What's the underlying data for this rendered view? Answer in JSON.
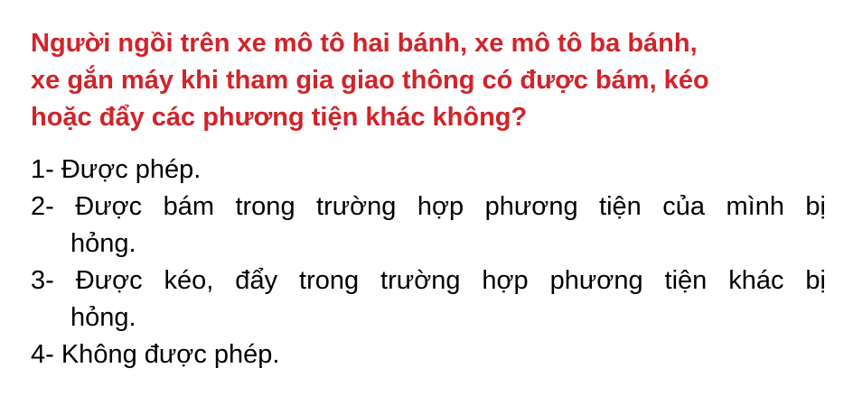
{
  "question": {
    "lines": [
      "Người ngồi trên xe mô tô hai bánh, xe mô tô ba bánh,",
      "xe gắn máy khi tham gia giao thông có được bám, kéo",
      "hoặc đẩy các phương tiện khác không?"
    ],
    "color": "#d2232a"
  },
  "answers": [
    {
      "lines": [
        "1- Được phép."
      ]
    },
    {
      "lines": [
        "2- Được bám trong trường hợp phương tiện của mình bị",
        "hỏng."
      ]
    },
    {
      "lines": [
        "3- Được kéo, đẩy trong trường hợp phương tiện khác bị",
        "hỏng."
      ]
    },
    {
      "lines": [
        "4- Không được phép."
      ]
    }
  ]
}
